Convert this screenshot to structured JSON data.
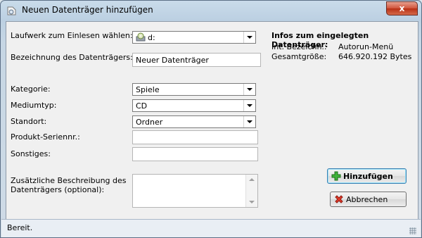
{
  "window": {
    "title": "Neuen Datenträger hinzufügen",
    "close_label": "x"
  },
  "form": {
    "drive_label": "Laufwerk zum Einlesen wählen:",
    "drive_value": "d:",
    "name_label": "Bezeichnung des Datenträgers:",
    "name_value": "Neuer Datenträger",
    "category_label": "Kategorie:",
    "category_value": "Spiele",
    "mediatype_label": "Mediumtyp:",
    "mediatype_value": "CD",
    "location_label": "Standort:",
    "location_value": "Ordner",
    "serial_label": "Produkt-Seriennr.:",
    "serial_value": "",
    "misc_label": "Sonstiges:",
    "misc_value": "",
    "desc_label_1": "Zusätzliche Beschreibung des",
    "desc_label_2": "Datenträgers (optional):",
    "desc_value": ""
  },
  "info": {
    "title": "Infos zum eingelegten Datenträger:",
    "int_label": "Int. Bezeichn.:",
    "int_value": "Autorun-Menü",
    "size_label": "Gesamtgröße:",
    "size_value": "646.920.192 Bytes"
  },
  "buttons": {
    "add_label": "Hinzufügen",
    "cancel_label": "Abbrechen"
  },
  "status": {
    "text": "Bereit."
  },
  "icons": {
    "window": "disc-add-icon",
    "drive": "cd-drive-icon",
    "add": "green-plus-icon",
    "cancel": "red-x-icon"
  }
}
